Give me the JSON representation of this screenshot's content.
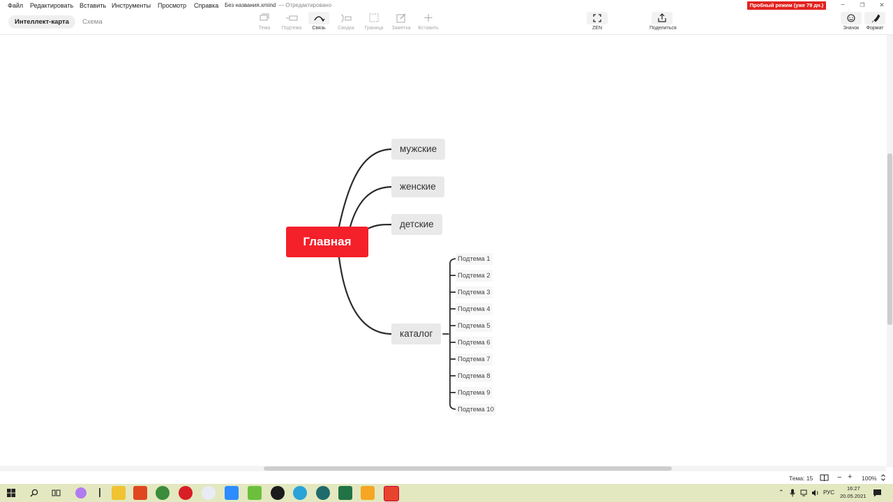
{
  "menu": {
    "items": [
      "Файл",
      "Редактировать",
      "Вставить",
      "Инструменты",
      "Просмотр",
      "Справка"
    ],
    "filename": "Без названия.xmind",
    "edited": "— Отредактировано",
    "trial_badge": "Пробный режим (уже 79 дн.)"
  },
  "window_controls": {
    "minimize": "–",
    "restore": "❐",
    "close": "✕"
  },
  "mode_tabs": {
    "mindmap": "Интеллект-карта",
    "scheme": "Схема"
  },
  "toolbar": {
    "topic": "Тема",
    "subtopic": "Подтема",
    "relation": "Связь",
    "summary": "Сводка",
    "boundary": "Граница",
    "note": "Заметка",
    "insert": "Вставить",
    "zen": "ZEN",
    "share": "Поделиться",
    "icon": "Значок",
    "format": "Формат"
  },
  "mindmap": {
    "central": "Главная",
    "branches": [
      "мужские",
      "женские",
      "детские",
      "каталог"
    ],
    "catalog_subtopics": [
      "Подтема 1",
      "Подтема 2",
      "Подтема 3",
      "Подтема 4",
      "Подтема 5",
      "Подтема 6",
      "Подтема 7",
      "Подтема 8",
      "Подтема 9",
      "Подтема 10"
    ],
    "central_color": "#f4202a",
    "line_color": "#2b2b2b"
  },
  "status": {
    "topic_count": "Тема: 15",
    "zoom": "100%",
    "zoom_minus": "−",
    "zoom_plus": "+"
  },
  "taskbar": {
    "language": "РУС",
    "time": "16:27",
    "date": "20.05.2021"
  }
}
